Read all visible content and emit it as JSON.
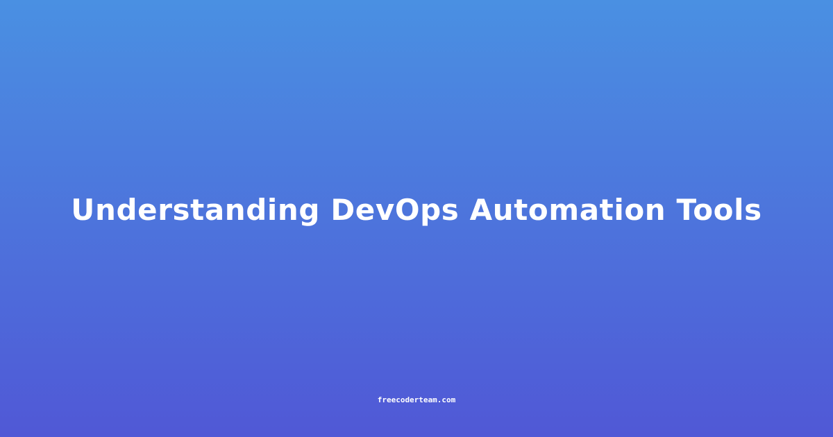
{
  "card": {
    "title": "Understanding DevOps Automation Tools",
    "site": "freecoderteam.com"
  },
  "colors": {
    "gradient_top": "#4a90e2",
    "gradient_bottom": "#5058d6",
    "text": "#ffffff"
  }
}
